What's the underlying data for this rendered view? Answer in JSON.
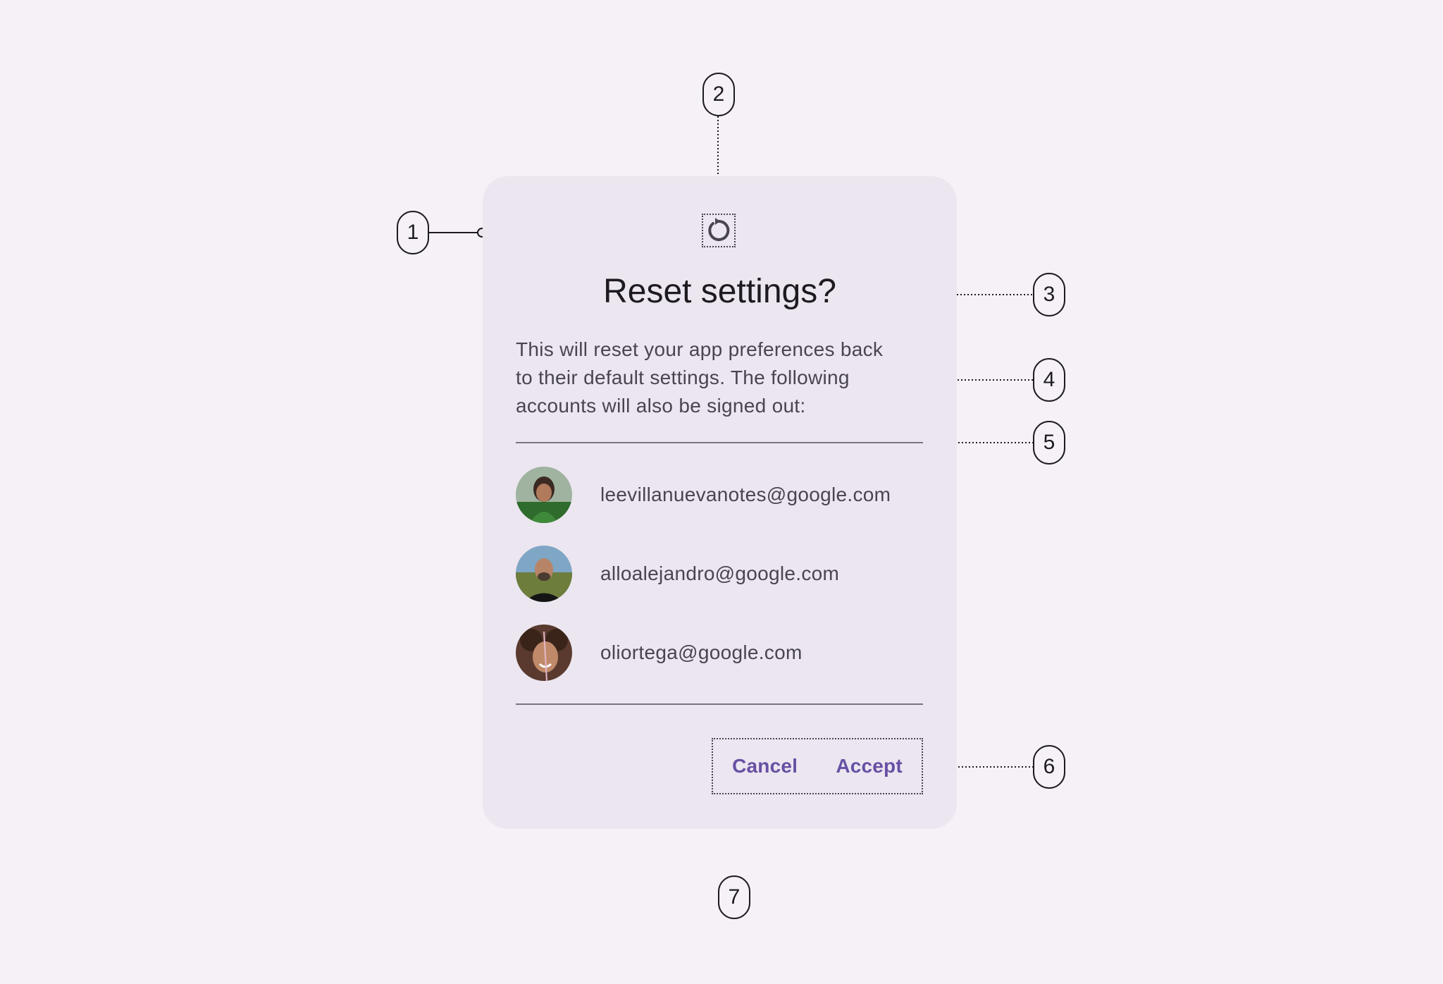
{
  "dialog": {
    "icon": "reset-icon",
    "title": "Reset settings?",
    "body_lines": [
      "This will reset your app preferences back",
      "to their default settings. The following",
      "accounts will also be signed out:"
    ],
    "accounts": [
      {
        "email": "leevillanuevanotes@google.com",
        "avatar": "avatar-photo"
      },
      {
        "email": "alloalejandro@google.com",
        "avatar": "avatar-photo"
      },
      {
        "email": "oliortega@google.com",
        "avatar": "avatar-photo"
      }
    ],
    "actions": {
      "cancel_label": "Cancel",
      "accept_label": "Accept"
    }
  },
  "callouts": [
    "1",
    "2",
    "3",
    "4",
    "5",
    "6",
    "7"
  ],
  "colors": {
    "background": "#f5f1f7",
    "surface": "#ece6f0",
    "primary": "#6750a4",
    "on_surface": "#1d1b20",
    "on_surface_variant": "#49454f",
    "outline": "#79747e"
  }
}
